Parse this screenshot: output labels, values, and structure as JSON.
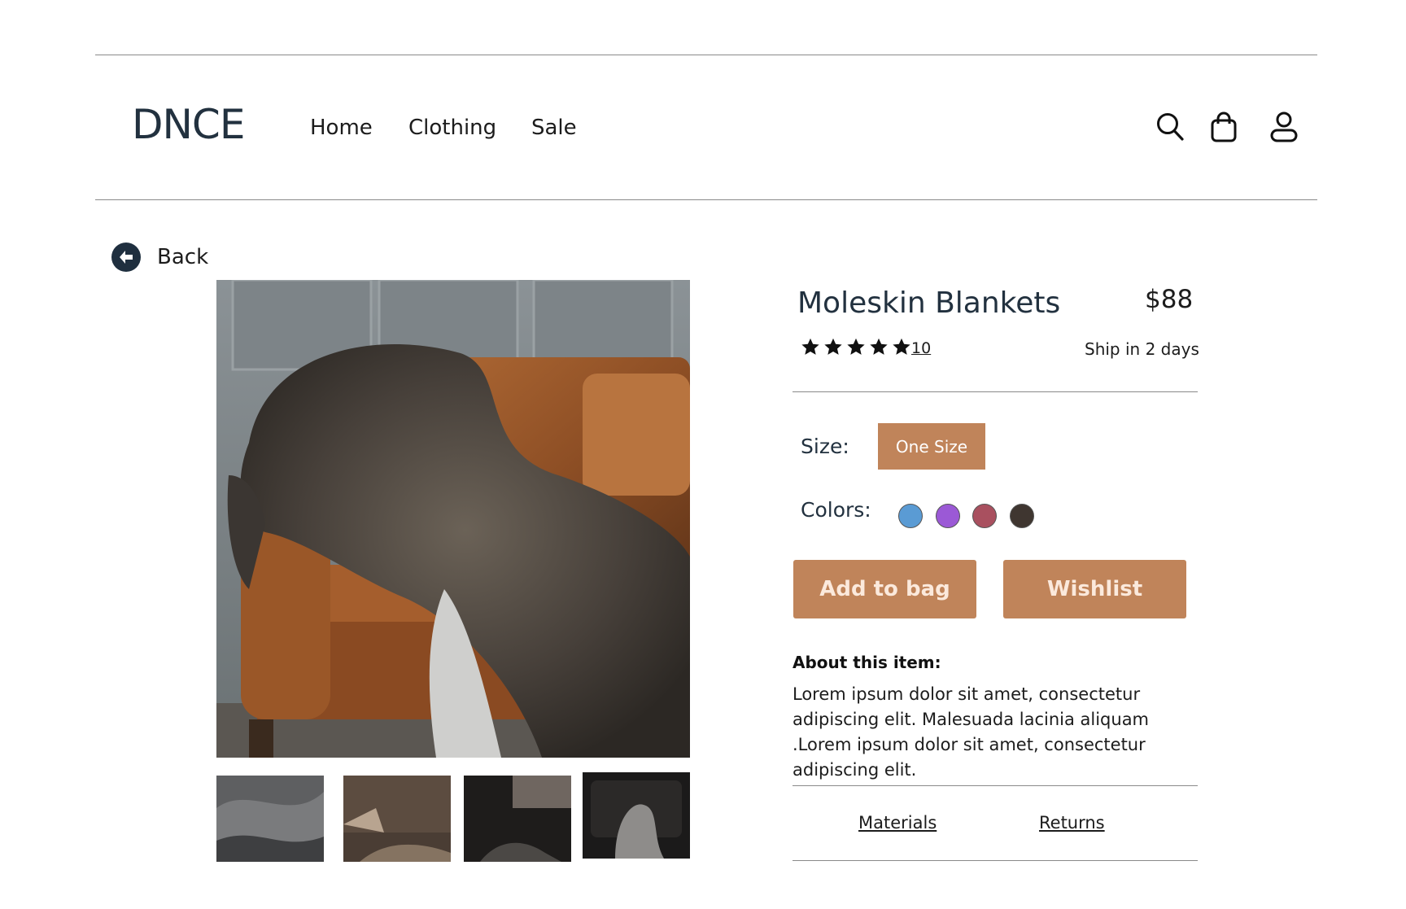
{
  "header": {
    "logo": "DNCE",
    "nav": [
      "Home",
      "Clothing",
      "Sale"
    ],
    "icons": [
      "search-icon",
      "shopping-bag-icon",
      "user-icon"
    ]
  },
  "back": {
    "label": "Back",
    "icon": "arrow-left-circle-icon"
  },
  "product": {
    "title": "Moleskin Blankets",
    "price": "$88",
    "rating": 5,
    "review_count": "10",
    "shipping": "Ship in 2 days",
    "size_label": "Size:",
    "size_option": "One Size",
    "colors_label": "Colors:",
    "colors": [
      "#5a9bd4",
      "#9b59d6",
      "#a9505f",
      "#3f3630"
    ],
    "accent": "#c0845a",
    "add_to_bag": "Add to bag",
    "wishlist": "Wishlist",
    "about_heading": "About this item:",
    "about_text": "Lorem ipsum dolor sit amet, consectetur adipiscing elit. Malesuada lacinia aliquam .Lorem ipsum dolor sit amet, consectetur adipiscing elit.",
    "tabs": [
      "Materials",
      "Returns"
    ]
  },
  "images": {
    "main": "blanket-on-leather-sofa",
    "thumbnails": [
      "fur-blanket-closeup",
      "bed-in-dim-light",
      "dark-bedroom-window",
      "blanket-on-dark-sofa"
    ]
  }
}
